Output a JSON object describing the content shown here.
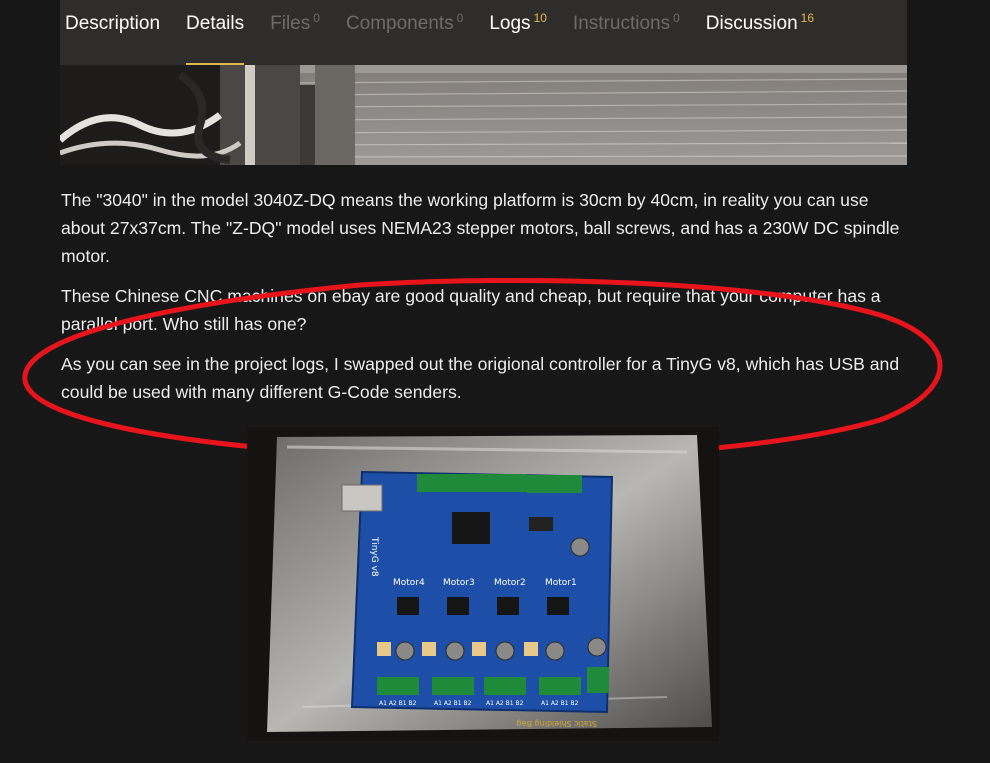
{
  "tabs": [
    {
      "label": "Description",
      "count": "",
      "state": "normal"
    },
    {
      "label": "Details",
      "count": "",
      "state": "active"
    },
    {
      "label": "Files",
      "count": "0",
      "state": "disabled"
    },
    {
      "label": "Components",
      "count": "0",
      "state": "disabled"
    },
    {
      "label": "Logs",
      "count": "10",
      "state": "normal"
    },
    {
      "label": "Instructions",
      "count": "0",
      "state": "disabled"
    },
    {
      "label": "Discussion",
      "count": "16",
      "state": "normal"
    }
  ],
  "paragraphs": [
    "The \"3040\" in the model 3040Z-DQ means the working platform is 30cm by 40cm, in reality you can use about 27x37cm. The \"Z-DQ\" model uses NEMA23 stepper motors, ball screws, and has a 230W DC spindle motor.",
    "These Chinese CNC machines on ebay are good quality and cheap, but require that your computer has a parallel port. Who still has one?",
    "As you can see in the project logs, I swapped out the origional controller for a TinyG v8, which has USB and could be used with many different G-Code senders."
  ],
  "board": {
    "motor_labels": [
      "Motor4",
      "Motor3",
      "Motor2",
      "Motor1"
    ],
    "pin_labels": [
      "A1 A2 B1 B2",
      "A1 A2 B1 B2",
      "A1 A2 B1 B2",
      "A1 A2 B1 B2"
    ],
    "bag_text": "Static Shielding Bag",
    "brand_text": "TinyG v8"
  },
  "colors": {
    "accent": "#e2b64b",
    "annotation": "#e8141c",
    "board": "#1d4fa8"
  }
}
